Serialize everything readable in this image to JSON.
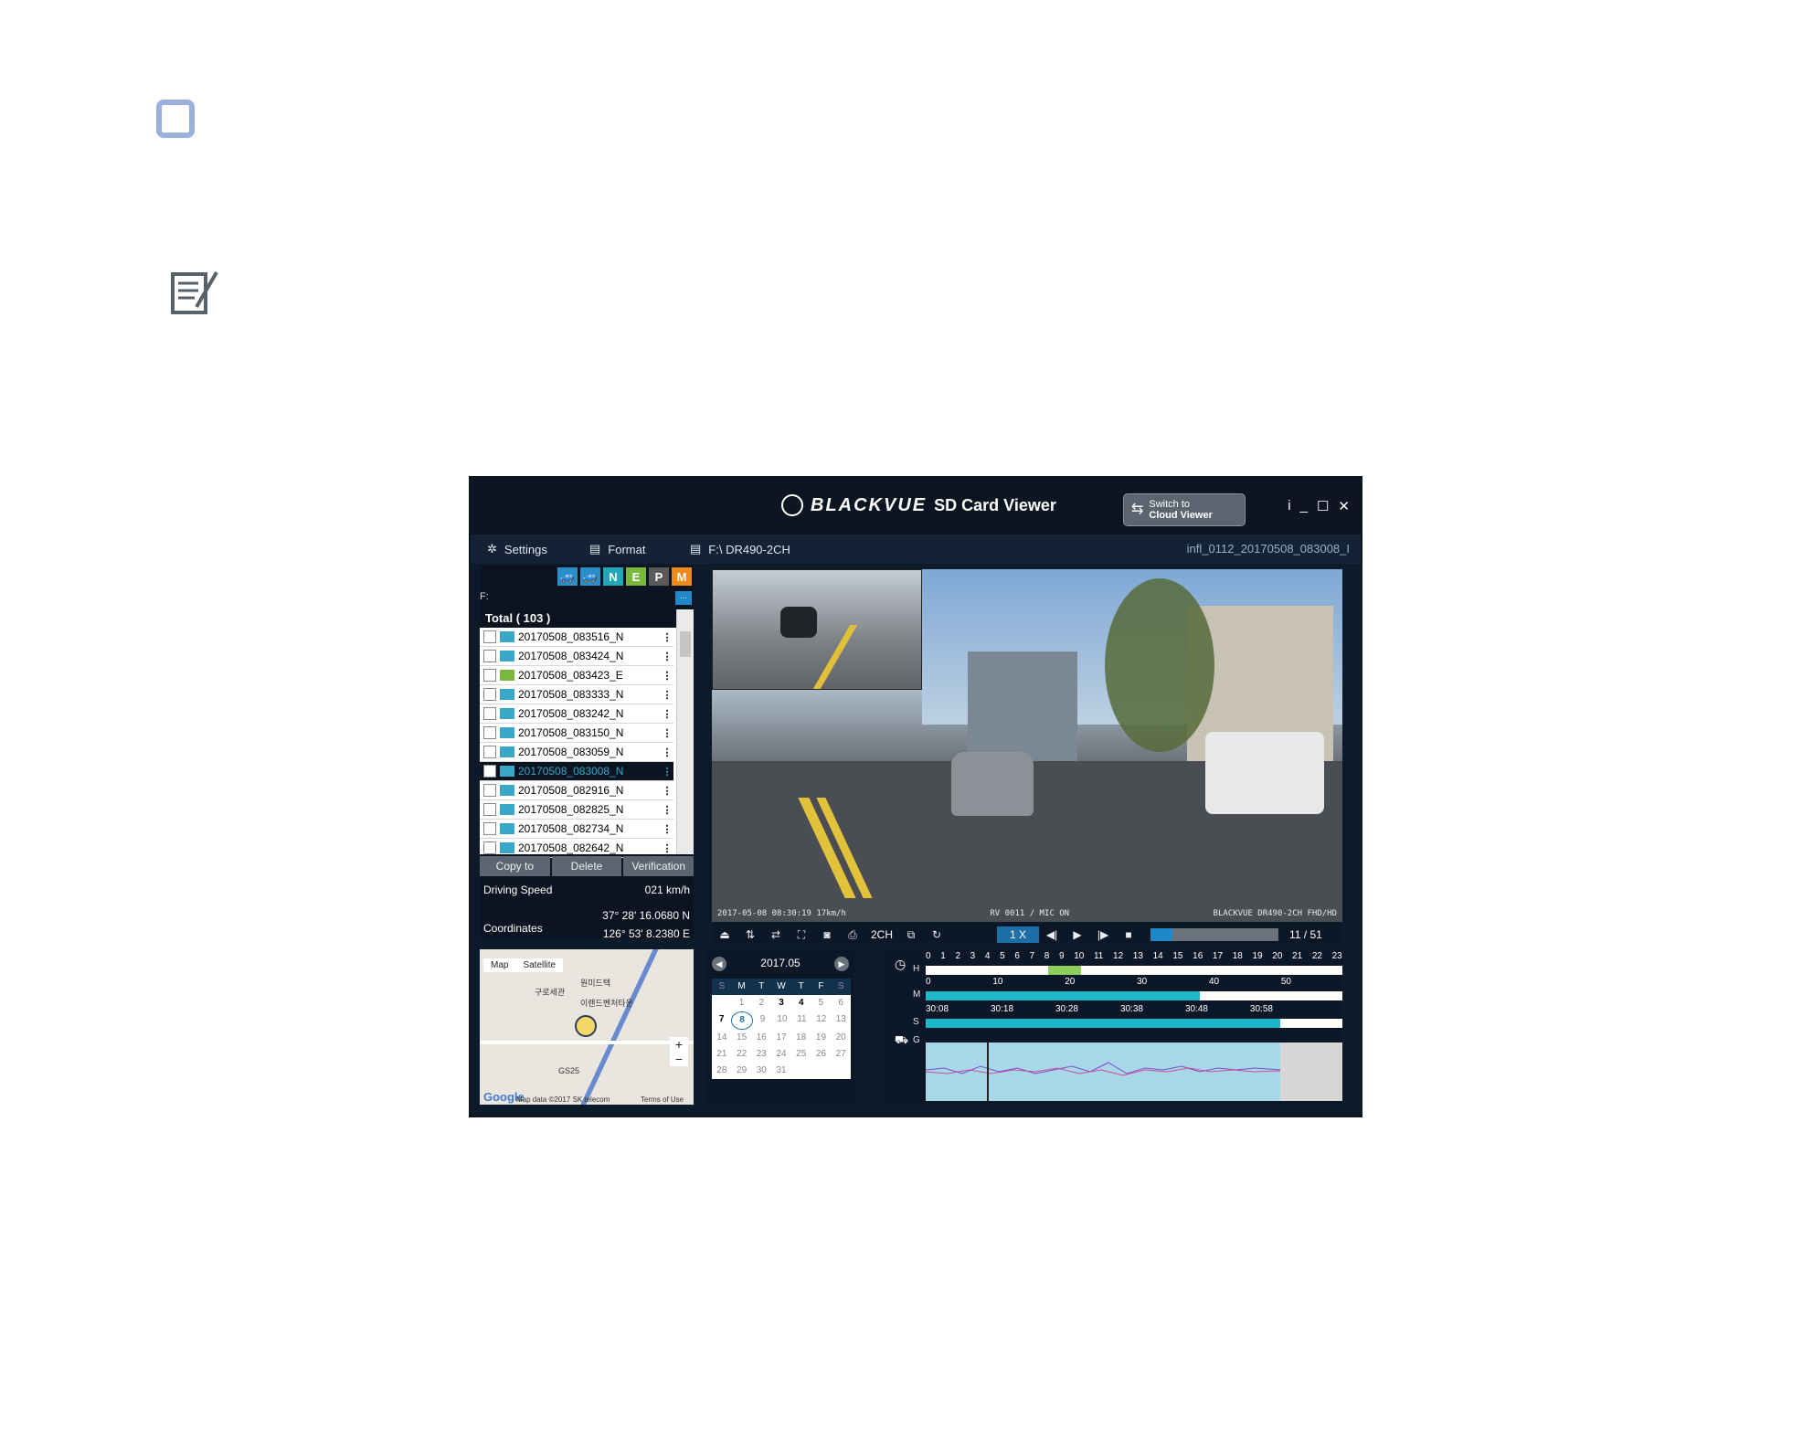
{
  "app": {
    "brand_name": "BLACKVUE",
    "brand_sub": "SD Card Viewer",
    "switch_line1": "Switch to",
    "switch_line2": "Cloud Viewer",
    "win_info": "i",
    "win_min": "_",
    "win_max": "☐",
    "win_close": "✕"
  },
  "menu": {
    "settings": "Settings",
    "format": "Format",
    "drive": "F:\\ DR490-2CH",
    "current_file": "infl_0112_20170508_083008_I"
  },
  "filters": [
    "N",
    "E",
    "P",
    "M"
  ],
  "path": "F:",
  "path_more": "...",
  "filelist": {
    "total": "Total ( 103 )",
    "rows": [
      {
        "name": "20170508_083516_N",
        "event": false,
        "selected": false
      },
      {
        "name": "20170508_083424_N",
        "event": false,
        "selected": false
      },
      {
        "name": "20170508_083423_E",
        "event": true,
        "selected": false
      },
      {
        "name": "20170508_083333_N",
        "event": false,
        "selected": false
      },
      {
        "name": "20170508_083242_N",
        "event": false,
        "selected": false
      },
      {
        "name": "20170508_083150_N",
        "event": false,
        "selected": false
      },
      {
        "name": "20170508_083059_N",
        "event": false,
        "selected": false
      },
      {
        "name": "20170508_083008_N",
        "event": false,
        "selected": true
      },
      {
        "name": "20170508_082916_N",
        "event": false,
        "selected": false
      },
      {
        "name": "20170508_082825_N",
        "event": false,
        "selected": false
      },
      {
        "name": "20170508_082734_N",
        "event": false,
        "selected": false
      },
      {
        "name": "20170508_082642_N",
        "event": false,
        "selected": false
      }
    ]
  },
  "actions": {
    "copy": "Copy to",
    "delete": "Delete",
    "verify": "Verification"
  },
  "info": {
    "speed_label": "Driving Speed",
    "speed_value": "021 km/h",
    "coord_label": "Coordinates",
    "lat": "37° 28' 16.0680 N",
    "lon": "126° 53' 8.2380 E"
  },
  "video": {
    "overlay_left": "2017-05-08 08:30:19  17km/h",
    "overlay_mid": "RV 0011 / MIC ON",
    "overlay_right": "BLACKVUE  DR490-2CH  FHD/HD"
  },
  "controls": {
    "ch": "2CH",
    "speed": "1 X",
    "progress_fraction": 0.17,
    "counter": "11 / 51"
  },
  "map": {
    "tab_map": "Map",
    "tab_sat": "Satellite",
    "zoom_in": "+",
    "zoom_out": "−",
    "attribution": "Map data ©2017 SK telecom",
    "terms": "Terms of Use",
    "google": "Google",
    "labels": [
      "원미드텍",
      "구로세관",
      "이랜드벤처타운",
      "GS25"
    ]
  },
  "calendar": {
    "month": "2017.05",
    "weekdays": [
      "S",
      "M",
      "T",
      "W",
      "T",
      "F",
      "S"
    ],
    "weeks": [
      [
        "",
        "1",
        "2",
        "3",
        "4",
        "5",
        "6"
      ],
      [
        "7",
        "8",
        "9",
        "10",
        "11",
        "12",
        "13"
      ],
      [
        "14",
        "15",
        "16",
        "17",
        "18",
        "19",
        "20"
      ],
      [
        "21",
        "22",
        "23",
        "24",
        "25",
        "26",
        "27"
      ],
      [
        "28",
        "29",
        "30",
        "31",
        "",
        "",
        ""
      ]
    ],
    "highlight_days": [
      "3",
      "4",
      "7"
    ],
    "selected_day": "8"
  },
  "timeline": {
    "hours": [
      "0",
      "1",
      "2",
      "3",
      "4",
      "5",
      "6",
      "7",
      "8",
      "9",
      "10",
      "11",
      "12",
      "13",
      "14",
      "15",
      "16",
      "17",
      "18",
      "19",
      "20",
      "21",
      "22",
      "23"
    ],
    "minutes": [
      "0",
      "10",
      "20",
      "30",
      "40",
      "50"
    ],
    "seconds": [
      "30:08",
      "30:18",
      "30:28",
      "30:38",
      "30:48",
      "30:58"
    ],
    "labels": {
      "h": "H",
      "m": "M",
      "s": "S",
      "g": "G"
    }
  },
  "colors": {
    "accent": "#1e88c8",
    "filter_n": "#22a6b8",
    "filter_e": "#7ab83c",
    "filter_p": "#5a5a5a",
    "filter_m": "#f08a1a"
  }
}
